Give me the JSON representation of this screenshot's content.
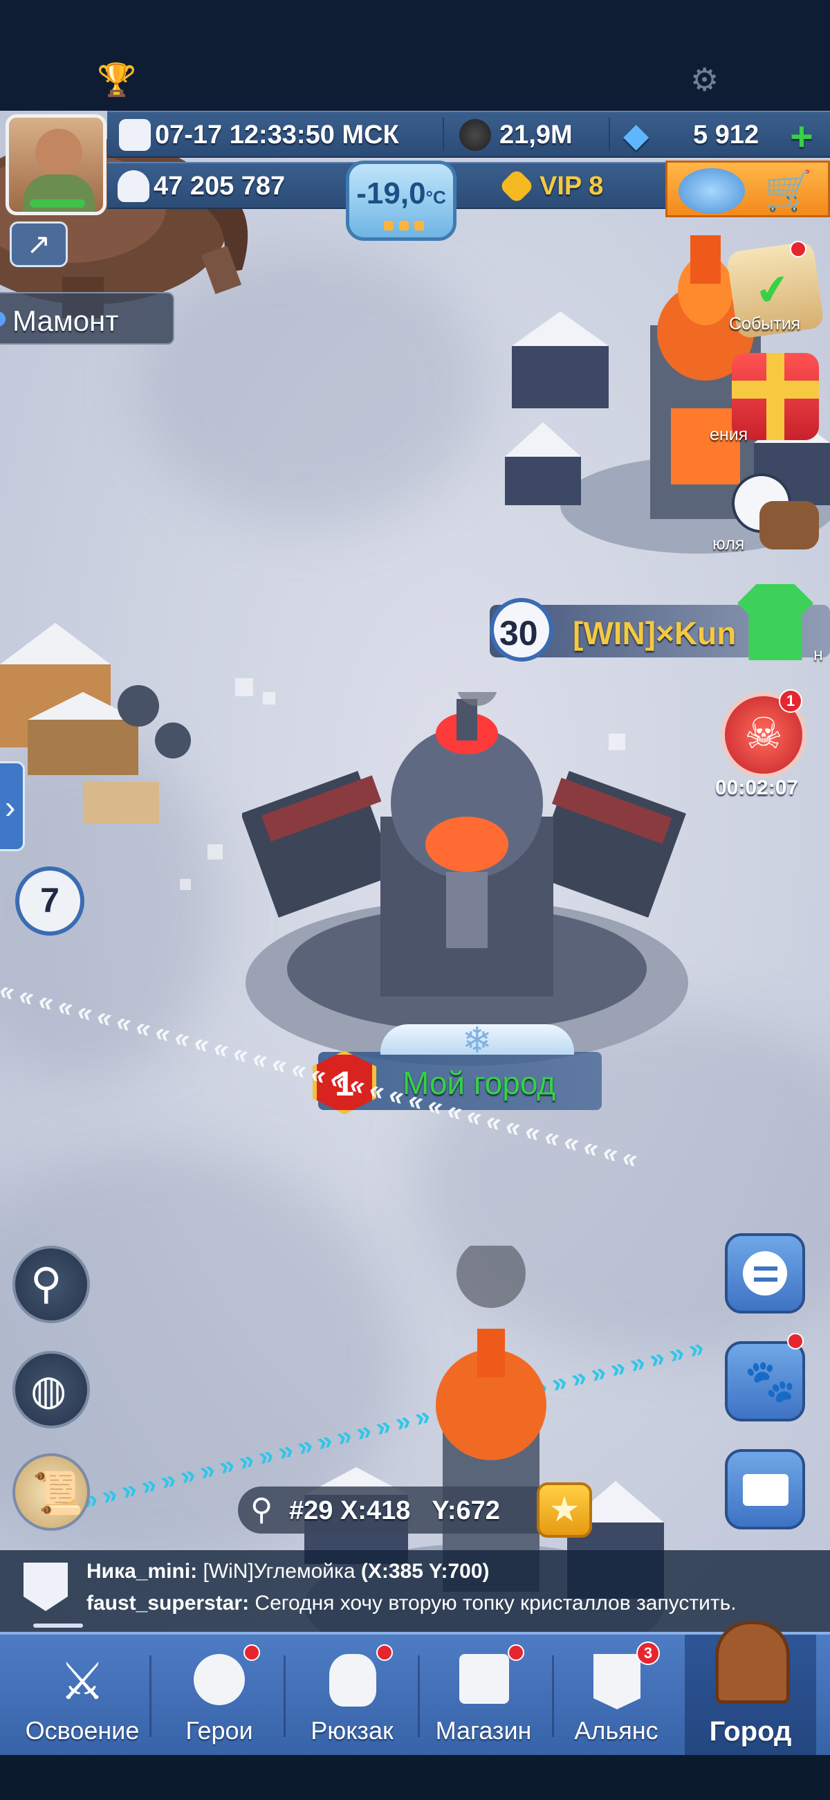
{
  "hud": {
    "datetime": "07-17 12:33:50 МСК",
    "coal": "21,9M",
    "gems": "5 912",
    "power": "47 205 787",
    "temperature": "-19,0",
    "temperature_unit": "°C",
    "vip": "VIP 8"
  },
  "map": {
    "mammoth_label": "Мамонт",
    "neighbor_level": "30",
    "neighbor_name": "[WIN]×Kun",
    "left_city_level": "7",
    "my_city_level": "1",
    "my_city_name": "Мой город",
    "coords": "#29 X:418   Y:672"
  },
  "side_events": [
    {
      "label": "События",
      "icon": "checklist-icon",
      "has_dot": true
    },
    {
      "label": "ения",
      "icon": "gift-icon",
      "has_dot": false
    },
    {
      "label": "юля",
      "icon": "football-boot-icon",
      "has_dot": false
    },
    {
      "label": "н",
      "icon": "jersey-icon",
      "has_dot": false
    }
  ],
  "raid": {
    "badge": "1",
    "timer": "00:02:07"
  },
  "chat": [
    {
      "user": "Ника_mini:",
      "text": " [WiN]Углемойка ",
      "extra": "(X:385 Y:700)"
    },
    {
      "user": "faust_superstar:",
      "text": " Сегодня хочу вторую топку кристаллов запустить.",
      "extra": ""
    }
  ],
  "nav": [
    {
      "label": "Освоение",
      "icon": "crossed-swords-icon",
      "dot": false,
      "badge": ""
    },
    {
      "label": "Герои",
      "icon": "hero-face-icon",
      "dot": true,
      "badge": ""
    },
    {
      "label": "Рюкзак",
      "icon": "sack-icon",
      "dot": true,
      "badge": ""
    },
    {
      "label": "Магазин",
      "icon": "shop-icon",
      "dot": true,
      "badge": ""
    },
    {
      "label": "Альянс",
      "icon": "alliance-flag-icon",
      "dot": false,
      "badge": "3"
    },
    {
      "label": "Город",
      "icon": "city-gate-icon",
      "dot": false,
      "badge": ""
    }
  ],
  "colors": {
    "hud_blue": "#2c4c77",
    "nav_blue": "#3f6bb3",
    "my_city_green": "#37d145",
    "neighbor_gold": "#f5c842",
    "badge_red": "#e5262f"
  }
}
